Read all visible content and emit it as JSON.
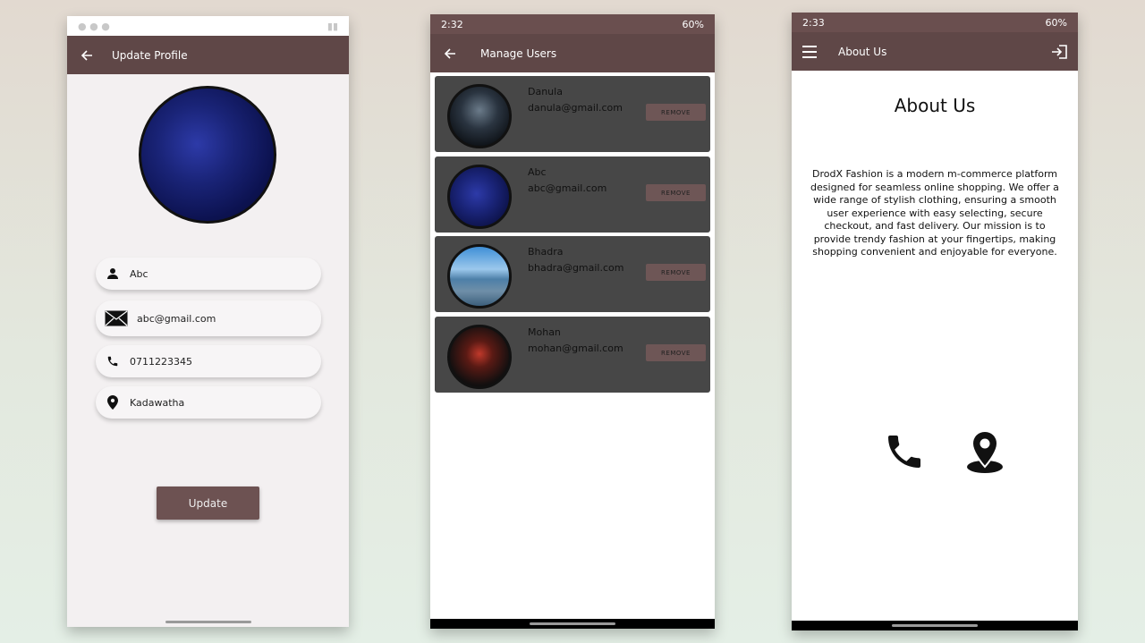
{
  "profile_screen": {
    "title": "Update Profile",
    "fields": [
      {
        "icon": "person-icon",
        "value": "Abc"
      },
      {
        "icon": "mail-icon",
        "value": "abc@gmail.com"
      },
      {
        "icon": "phone-icon",
        "value": "0711223345"
      },
      {
        "icon": "location-icon",
        "value": "Kadawatha"
      }
    ],
    "update_label": "Update"
  },
  "manage_users_screen": {
    "time": "2:32",
    "battery": "60%",
    "title": "Manage Users",
    "users": [
      {
        "name": "Danula",
        "email": "danula@gmail.com",
        "remove_label": "REMOVE"
      },
      {
        "name": "Abc",
        "email": "abc@gmail.com",
        "remove_label": "REMOVE"
      },
      {
        "name": "Bhadra",
        "email": "bhadra@gmail.com",
        "remove_label": "REMOVE"
      },
      {
        "name": "Mohan",
        "email": "mohan@gmail.com",
        "remove_label": "REMOVE"
      }
    ]
  },
  "about_screen": {
    "time": "2:33",
    "battery": "60%",
    "appbar_title": "About Us",
    "heading": "About Us",
    "description": "DrodX Fashion is a modern m-commerce platform designed for seamless online shopping. We offer a wide range of stylish clothing, ensuring a smooth user experience with easy selecting, secure checkout, and fast delivery. Our mission is to provide trendy fashion at your fingertips, making shopping convenient and enjoyable for everyone."
  },
  "colors": {
    "appbar": "#5f4747",
    "card": "#474747",
    "button": "#6d5252"
  }
}
